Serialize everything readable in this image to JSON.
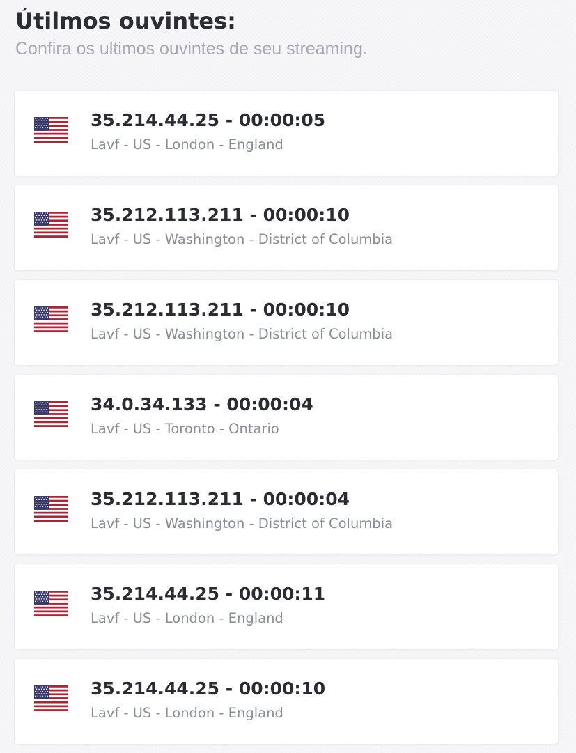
{
  "header": {
    "title": "Útilmos ouvintes:",
    "subtitle": "Confira os ultimos ouvintes de seu streaming."
  },
  "listeners": [
    {
      "flag": "us-flag-icon",
      "ip_time": "35.214.44.25 - 00:00:05",
      "details": "Lavf - US - London - England"
    },
    {
      "flag": "us-flag-icon",
      "ip_time": "35.212.113.211 - 00:00:10",
      "details": "Lavf - US - Washington - District of Columbia"
    },
    {
      "flag": "us-flag-icon",
      "ip_time": "35.212.113.211 - 00:00:10",
      "details": "Lavf - US - Washington - District of Columbia"
    },
    {
      "flag": "us-flag-icon",
      "ip_time": "34.0.34.133 - 00:00:04",
      "details": "Lavf - US - Toronto - Ontario"
    },
    {
      "flag": "us-flag-icon",
      "ip_time": "35.212.113.211 - 00:00:04",
      "details": "Lavf - US - Washington - District of Columbia"
    },
    {
      "flag": "us-flag-icon",
      "ip_time": "35.214.44.25 - 00:00:11",
      "details": "Lavf - US - London - England"
    },
    {
      "flag": "us-flag-icon",
      "ip_time": "35.214.44.25 - 00:00:10",
      "details": "Lavf - US - London - England"
    }
  ],
  "colors": {
    "background": "#f7f7f9",
    "card": "#ffffff",
    "title": "#2c2c34",
    "subtitle": "#a6a8b8",
    "detail_text": "#8b8d99",
    "flag_red": "#b22234",
    "flag_blue": "#3c3b6e"
  }
}
